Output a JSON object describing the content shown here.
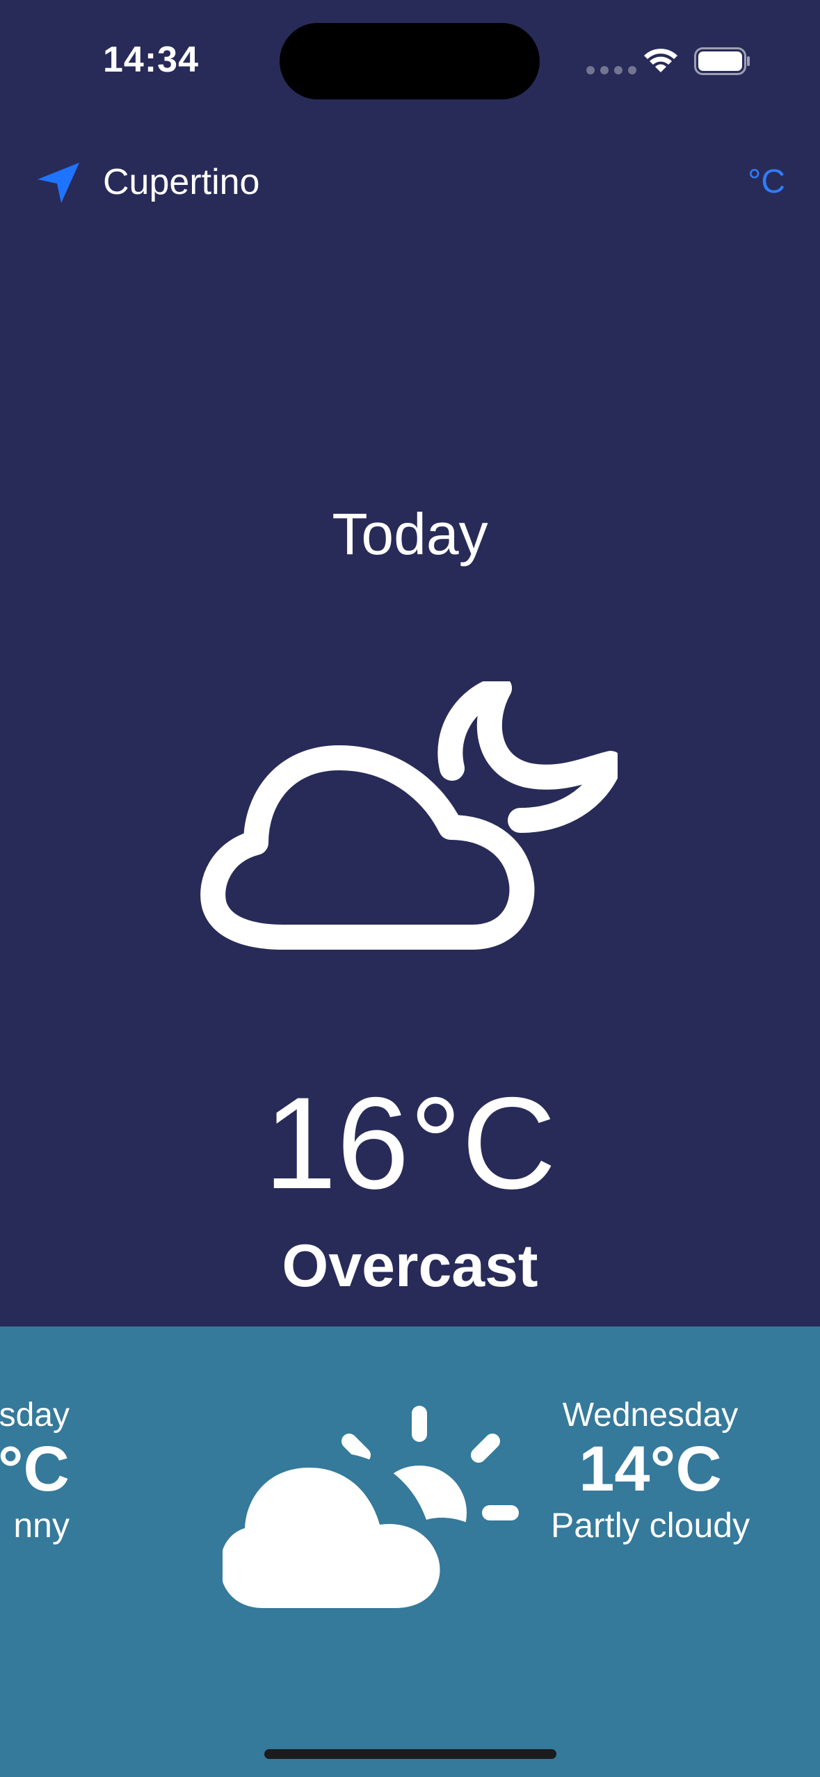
{
  "status_bar": {
    "time": "14:34"
  },
  "header": {
    "location": "Cupertino",
    "unit_toggle": "°C"
  },
  "current": {
    "label": "Today",
    "temperature": "16°C",
    "condition": "Overcast",
    "icon": "cloud-moon-icon"
  },
  "forecast": {
    "prev": {
      "day": "sday",
      "temperature": "°C",
      "condition": "nny"
    },
    "next": {
      "day": "Wednesday",
      "temperature": "14°C",
      "condition": "Partly cloudy",
      "icon": "cloud-sun-icon"
    }
  },
  "colors": {
    "background": "#282b58",
    "forecast_panel": "#35799b",
    "accent": "#2f7dff"
  }
}
